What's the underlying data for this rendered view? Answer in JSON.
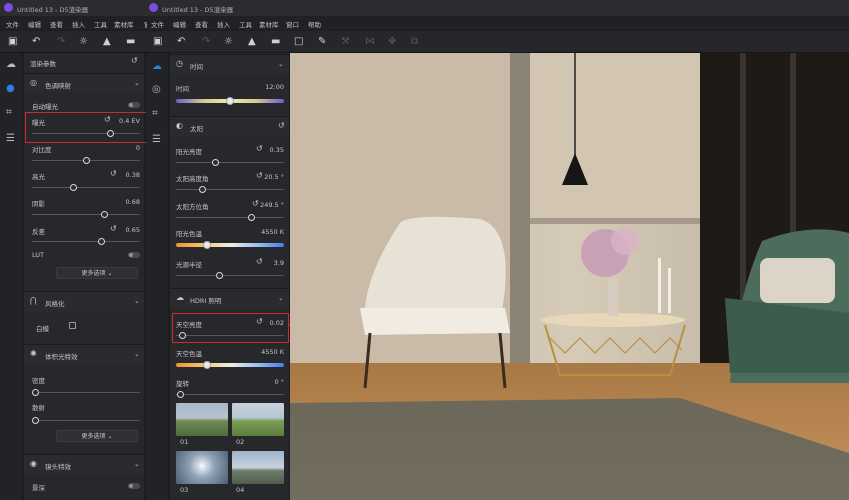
{
  "colors": {
    "accent": "#2f7de1",
    "highlight_box": "#d4282c",
    "logo": "#7b4de0"
  },
  "windows": [
    {
      "title": "Untitled 13 - D5渲染器"
    },
    {
      "title": "Untitled 13 - D5渲染器"
    }
  ],
  "menu_left": [
    "文件",
    "编辑",
    "查看",
    "插入",
    "工具",
    "素材库",
    "窗口"
  ],
  "menu_right": [
    "文件",
    "编辑",
    "查看",
    "插入",
    "工具",
    "素材库",
    "窗口",
    "帮助"
  ],
  "left_panel": {
    "header": "渲染参数",
    "tonemap": {
      "title": "色调映射",
      "auto_exposure": "自动曝光",
      "exposure": {
        "label": "曝光",
        "value": "0.4 EV",
        "pos": 0.68
      },
      "contrast": {
        "label": "对比度",
        "value": "0",
        "pos": 0.5
      },
      "highlight": {
        "label": "高光",
        "value": "0.38",
        "pos": 0.3
      },
      "shadow": {
        "label": "阴影",
        "value": "0.68",
        "pos": 0.66
      },
      "saturation": {
        "label": "反差",
        "value": "0.65",
        "pos": 0.63
      },
      "lut": "LUT",
      "more": "更多选项"
    },
    "stylize": {
      "title": "风格化",
      "item": "白模"
    },
    "volumetric": {
      "title": "体积光特效",
      "density": "密度",
      "scatter": "散射",
      "more": "更多选项"
    },
    "lens": {
      "title": "镜头特效",
      "item": "景深"
    }
  },
  "right_panel": {
    "time": {
      "title": "时间",
      "label": "时间",
      "value": "12:00",
      "pos": 0.5
    },
    "sun": {
      "title": "太阳",
      "brightness": {
        "label": "阳光亮度",
        "value": "0.35",
        "pos": 0.35
      },
      "altitude": {
        "label": "太阳高度角",
        "value": "20.5 °",
        "pos": 0.25
      },
      "azimuth": {
        "label": "太阳方位角",
        "value": "249.5 °",
        "pos": 0.69
      },
      "color_temp": {
        "label": "阳光色温",
        "value": "4550 K",
        "pos": 0.27
      },
      "radius": {
        "label": "光源半径",
        "value": "3.9",
        "pos": 0.39
      }
    },
    "hdri": {
      "title": "HDRI 照明",
      "sky_brightness": {
        "label": "天空亮度",
        "value": "0.02",
        "pos": 0.03
      },
      "sky_temp": {
        "label": "天空色温",
        "value": "4550 K",
        "pos": 0.27
      },
      "rotation": {
        "label": "旋转",
        "value": "0 °",
        "pos": 0.02
      },
      "thumbs": [
        {
          "label": "01"
        },
        {
          "label": "02"
        },
        {
          "label": "03"
        },
        {
          "label": "04"
        }
      ]
    }
  }
}
